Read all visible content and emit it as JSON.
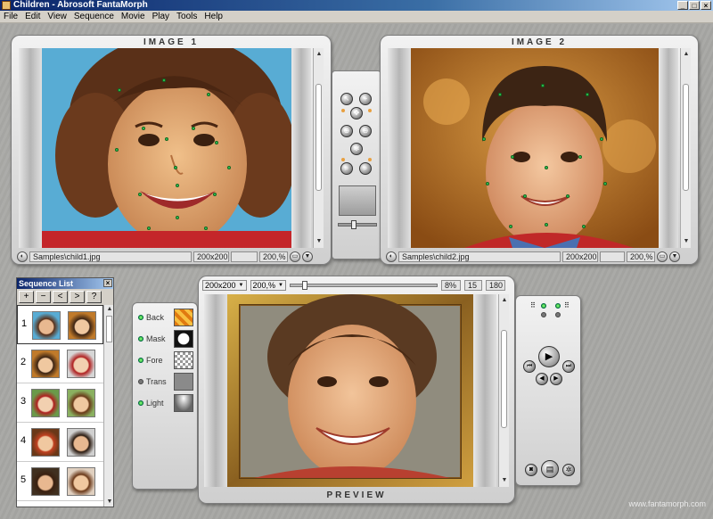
{
  "window": {
    "title": "Children - Abrosoft FantaMorph",
    "minimize": "_",
    "maximize": "□",
    "close": "×"
  },
  "menu": [
    "File",
    "Edit",
    "View",
    "Sequence",
    "Movie",
    "Play",
    "Tools",
    "Help"
  ],
  "image1": {
    "title": "IMAGE 1",
    "path": "Samples\\child1.jpg",
    "size": "200x200",
    "zoom": "200,%"
  },
  "image2": {
    "title": "IMAGE 2",
    "path": "Samples\\child2.jpg",
    "size": "200x200",
    "zoom": "200,%"
  },
  "sequence": {
    "title": "Sequence List",
    "close": "×",
    "toolbar": [
      "+",
      "−",
      "<",
      ">",
      "?"
    ],
    "rows": [
      "1",
      "2",
      "3",
      "4",
      "5"
    ]
  },
  "preview": {
    "title": "PREVIEW",
    "size": "200x200",
    "zoom": "200,%",
    "progress_percent": "8%",
    "frame": "15",
    "total": "180",
    "slider_fraction": 0.08,
    "layers": [
      {
        "label": "Back",
        "on": true
      },
      {
        "label": "Mask",
        "on": true
      },
      {
        "label": "Fore",
        "on": true
      },
      {
        "label": "Trans",
        "on": false
      },
      {
        "label": "Light",
        "on": true
      }
    ]
  },
  "watermark": "www.fantamorph.com",
  "colors": {
    "dot": "#33cc55",
    "titlebar": "#0a246a",
    "panel": "#d8d8d8"
  }
}
